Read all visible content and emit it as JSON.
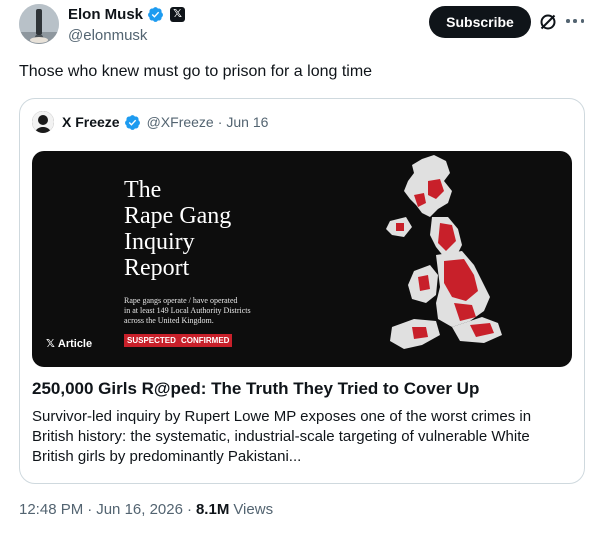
{
  "author": {
    "display_name": "Elon Musk",
    "handle": "@elonmusk"
  },
  "actions": {
    "subscribe_label": "Subscribe"
  },
  "tweet": {
    "text": "Those who knew must go to prison for a long time"
  },
  "quote": {
    "display_name": "X Freeze",
    "handle": "@XFreeze",
    "separator": "·",
    "date": "Jun 16",
    "image": {
      "title": "The\nRape Gang\nInquiry\nReport",
      "subtitle": "Rape gangs operate / have operated\nin at least 149 Local Authority Districts\nacross the United Kingdom.",
      "tag_suspected": "SUSPECTED",
      "tag_confirmed": "CONFIRMED",
      "article_badge": "Article"
    },
    "article_title": "250,000 Girls R@ped: The Truth They Tried to Cover Up",
    "article_description": "Survivor-led inquiry by Rupert Lowe MP exposes one of the worst crimes in British history: the systematic, industrial-scale targeting of vulnerable White British girls by predominantly Pakistani..."
  },
  "meta": {
    "time": "12:48 PM",
    "separator": "·",
    "date": "Jun 16, 2026",
    "separator2": "·",
    "views_count": "8.1M",
    "views_label": "Views"
  },
  "colors": {
    "verified": "#1d9bf0",
    "text_primary": "#0f1419",
    "text_secondary": "#536471",
    "border": "#cfd9de",
    "map_red": "#c8202a"
  }
}
